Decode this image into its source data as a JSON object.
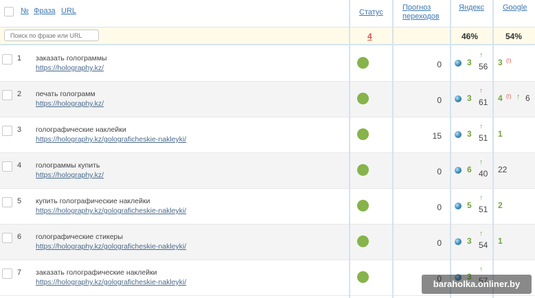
{
  "header": {
    "no_label": "№",
    "phrase_label": "Фраза",
    "url_label": "URL",
    "status_label": "Статус",
    "forecast_label": "Прогноз переходов",
    "yandex_label": "Яндекс",
    "google_label": "Google"
  },
  "filter": {
    "search_placeholder": "Поиск по фразе или URL",
    "status_count": "4",
    "yandex_pct": "46%",
    "google_pct": "54%"
  },
  "colors": {
    "status_ok": "#86b34a",
    "position_green": "#72a33a",
    "flag_red": "#d9534f",
    "link_blue": "#3c78b4"
  },
  "rows": [
    {
      "num": "1",
      "phrase": "заказать голограммы",
      "url": "https://holography.kz/",
      "forecast": "0",
      "yandex": "3",
      "yandex_arrow": "↑",
      "yandex_prev": "56",
      "google": "3",
      "google_flag": "(!)",
      "google_arrow": "",
      "google_prev": "",
      "google_green": true
    },
    {
      "num": "2",
      "phrase": "печать голограмм",
      "url": "https://holography.kz/",
      "forecast": "0",
      "yandex": "3",
      "yandex_arrow": "↑",
      "yandex_prev": "61",
      "google": "4",
      "google_flag": "(!)",
      "google_arrow": "↑",
      "google_prev": "6",
      "google_green": true
    },
    {
      "num": "3",
      "phrase": "голографические наклейки",
      "url": "https://holography.kz/golograficheskie-nakleyki/",
      "forecast": "15",
      "yandex": "3",
      "yandex_arrow": "↑",
      "yandex_prev": "51",
      "google": "1",
      "google_flag": "",
      "google_arrow": "",
      "google_prev": "",
      "google_green": true
    },
    {
      "num": "4",
      "phrase": "голограммы купить",
      "url": "https://holography.kz/",
      "forecast": "0",
      "yandex": "6",
      "yandex_arrow": "↑",
      "yandex_prev": "40",
      "google": "22",
      "google_flag": "",
      "google_arrow": "",
      "google_prev": "",
      "google_green": false
    },
    {
      "num": "5",
      "phrase": "купить голографические наклейки",
      "url": "https://holography.kz/golograficheskie-nakleyki/",
      "forecast": "0",
      "yandex": "5",
      "yandex_arrow": "↑",
      "yandex_prev": "51",
      "google": "2",
      "google_flag": "",
      "google_arrow": "",
      "google_prev": "",
      "google_green": true
    },
    {
      "num": "6",
      "phrase": "голографические стикеры",
      "url": "https://holography.kz/golograficheskie-nakleyki/",
      "forecast": "0",
      "yandex": "3",
      "yandex_arrow": "↑",
      "yandex_prev": "54",
      "google": "1",
      "google_flag": "",
      "google_arrow": "",
      "google_prev": "",
      "google_green": true
    },
    {
      "num": "7",
      "phrase": "заказать голографические наклейки",
      "url": "https://holography.kz/golograficheskie-nakleyki/",
      "forecast": "0",
      "yandex": "3",
      "yandex_arrow": "↑",
      "yandex_prev": "57",
      "google": "",
      "google_flag": "",
      "google_arrow": "",
      "google_prev": "",
      "google_green": true
    }
  ],
  "watermark": "baraholka.onliner.by"
}
